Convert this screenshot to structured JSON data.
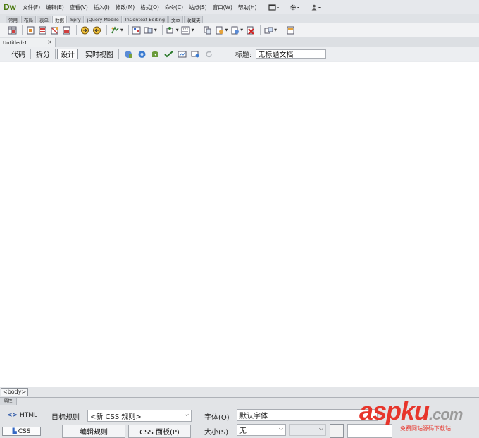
{
  "app": {
    "logo": "Dw",
    "menu": [
      "文件(F)",
      "编辑(E)",
      "查看(V)",
      "插入(I)",
      "修改(M)",
      "格式(O)",
      "命令(C)",
      "站点(S)",
      "窗口(W)",
      "帮助(H)"
    ],
    "menu_right_icons": [
      "layout-icon",
      "gear-icon",
      "user-icon"
    ]
  },
  "insert_tabs": {
    "items": [
      "常用",
      "布局",
      "表单",
      "数据",
      "Spry",
      "jQuery Mobile",
      "InContext Editing",
      "文本",
      "收藏夹"
    ],
    "active_index": 3
  },
  "toolbar": {
    "icons": [
      "import-table-icon",
      "recordset-icon",
      "command-icon",
      "dynamic-data-icon",
      "repeat-region-icon",
      "show-region-icon",
      "recordset-paging-icon",
      "go-to-detail-icon",
      "display-record-count-icon",
      "master-detail-icon",
      "insert-record-icon",
      "update-record-icon",
      "delete-record-icon",
      "user-auth-icon",
      "xslt-icon"
    ]
  },
  "document": {
    "tab_name": "Untitled-1",
    "close_symbol": "×"
  },
  "doc_toolbar": {
    "views": [
      "代码",
      "拆分",
      "设计",
      "实时视图"
    ],
    "active_view_index": 2,
    "title_label": "标题:",
    "title_value": "无标题文档"
  },
  "status": {
    "tag": "<body>"
  },
  "properties": {
    "panel_title": "属性",
    "html_label": "HTML",
    "css_label": "CSS",
    "target_rule_label": "目标规则",
    "target_rule_value": "<新 CSS 规则>",
    "font_label": "字体(O)",
    "font_value": "默认字体",
    "size_label": "大小(S)",
    "size_value": "无",
    "edit_rule_button": "编辑规则",
    "css_panel_button": "CSS 面板(P)"
  },
  "watermark": {
    "logo_main": "aspku",
    "logo_suffix": ".com",
    "tagline": "免费网站源码下载站!"
  },
  "colors": {
    "brand_green": "#4a7a0f",
    "watermark_red": "#e7352b",
    "html_blue": "#2d58a8"
  }
}
